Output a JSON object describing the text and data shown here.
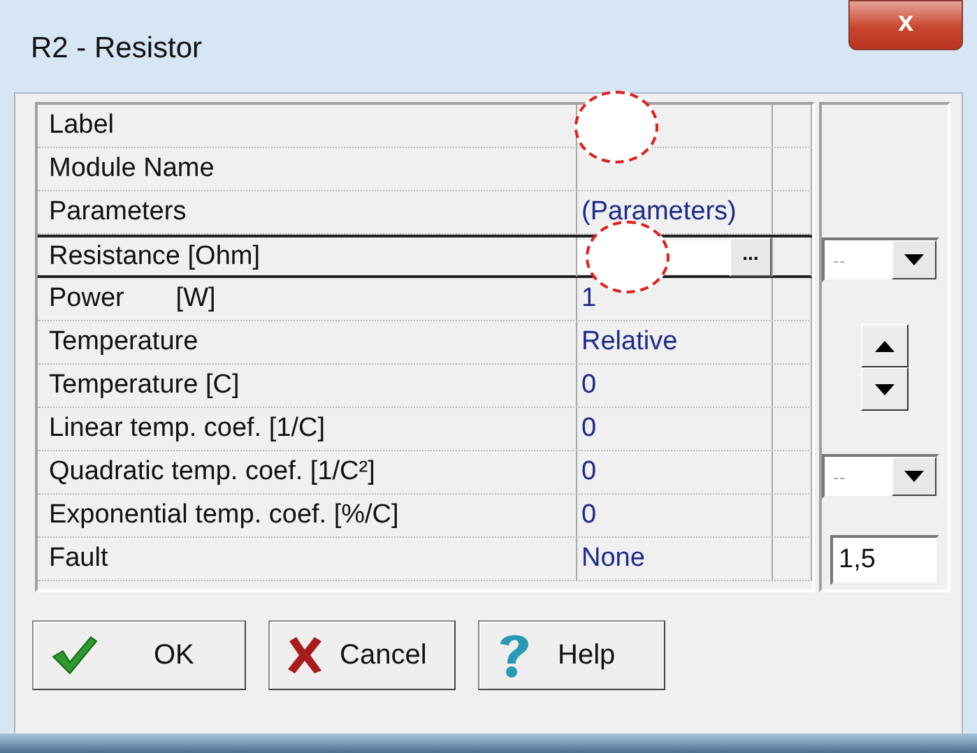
{
  "window": {
    "title": "R2 - Resistor",
    "close": "x"
  },
  "properties": [
    {
      "name": "Label",
      "kind": "text",
      "redacted": true,
      "selected": false
    },
    {
      "name": "Module Name",
      "kind": "text",
      "redacted": false,
      "selected": false
    },
    {
      "name": "Parameters",
      "kind": "text",
      "value": "(Parameters)",
      "redacted": false,
      "selected": false
    },
    {
      "name": "Resistance [Ohm]",
      "kind": "edit",
      "button": "...",
      "redacted": true,
      "selected": true
    },
    {
      "name": "Power       [W]",
      "kind": "text",
      "value": "1",
      "redacted": false,
      "selected": false
    },
    {
      "name": "Temperature",
      "kind": "text",
      "value": "Relative",
      "redacted": false,
      "selected": false
    },
    {
      "name": "Temperature [C]",
      "kind": "text",
      "value": "0",
      "redacted": false,
      "selected": false
    },
    {
      "name": "Linear temp. coef. [1/C]",
      "kind": "text",
      "value": "0",
      "redacted": false,
      "selected": false
    },
    {
      "name": "Quadratic temp. coef. [1/C²]",
      "kind": "text",
      "value": "0",
      "redacted": false,
      "selected": false
    },
    {
      "name": "Exponential temp. coef. [%/C]",
      "kind": "text",
      "value": "0",
      "redacted": false,
      "selected": false
    },
    {
      "name": "Fault",
      "kind": "text",
      "value": "None",
      "redacted": false,
      "selected": false
    }
  ],
  "side_panel": {
    "dropdown_1": "--",
    "dropdown_2": "--",
    "field": "1,5"
  },
  "buttons": [
    {
      "label": "OK",
      "kind": "ok"
    },
    {
      "label": "Cancel",
      "kind": "cancel"
    },
    {
      "label": "Help",
      "kind": "help"
    }
  ]
}
